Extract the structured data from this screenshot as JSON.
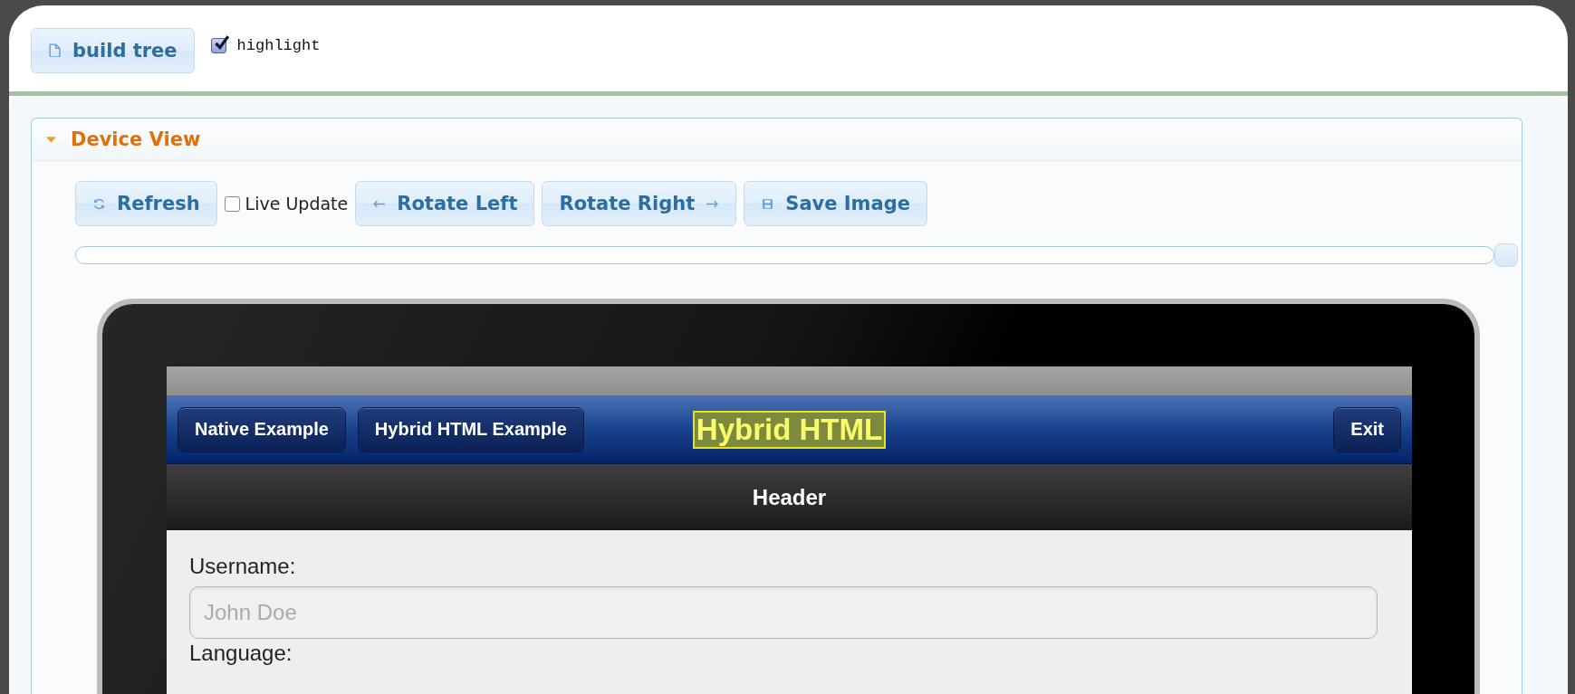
{
  "toolbar": {
    "build_button": {
      "label": "build tree"
    },
    "highlight": {
      "label": "highlight",
      "checked": true
    }
  },
  "device_view": {
    "title": "Device View",
    "expanded": true,
    "controls": [
      {
        "kind": "button",
        "label": "Refresh"
      },
      {
        "kind": "checkbox",
        "label": "Live Update",
        "checked": false
      },
      {
        "kind": "button",
        "label": "Rotate Left"
      },
      {
        "kind": "button",
        "label": "Rotate Right"
      },
      {
        "kind": "button",
        "label": "Save Image"
      }
    ],
    "slider": {
      "level": 1
    },
    "device": {
      "nav": {
        "buttons": [
          "Native Example",
          "Hybrid HTML Example"
        ],
        "title": "Hybrid HTML",
        "title_highlighted": true,
        "exit": "Exit"
      },
      "header": "Header",
      "form": {
        "fields": [
          {
            "label": "Username:",
            "placeholder": "John Doe"
          }
        ],
        "next_label": "Language:"
      }
    }
  }
}
